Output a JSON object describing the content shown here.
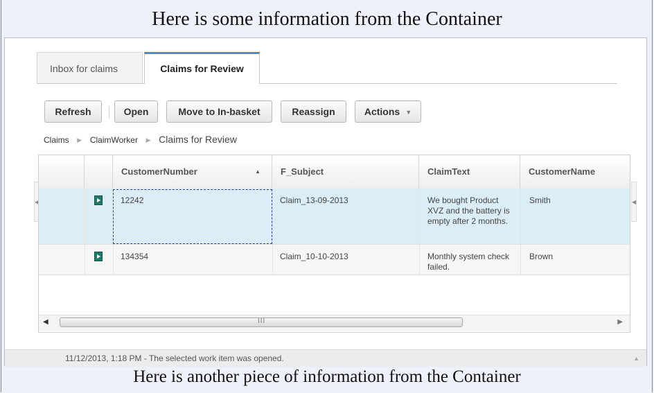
{
  "banner": {
    "top": "Here is some information from the Container",
    "bottom": "Here is another piece of information from the Container"
  },
  "tabs": [
    {
      "label": "Inbox for claims",
      "active": false
    },
    {
      "label": "Claims for Review",
      "active": true
    }
  ],
  "toolbar": {
    "refresh": "Refresh",
    "open": "Open",
    "move": "Move to In-basket",
    "reassign": "Reassign",
    "actions": "Actions"
  },
  "breadcrumb": [
    "Claims",
    "ClaimWorker",
    "Claims for Review"
  ],
  "table": {
    "columns": [
      "CustomerNumber",
      "F_Subject",
      "ClaimText",
      "CustomerName"
    ],
    "sort": {
      "column": "CustomerNumber",
      "direction": "ascending"
    },
    "rows": [
      {
        "icon": "workitem-icon",
        "CustomerNumber": "12242",
        "F_Subject": "Claim_13-09-2013",
        "ClaimText": "We bought Product XVZ and the battery is empty after 2 months.",
        "CustomerName": "Smith",
        "selected": true
      },
      {
        "icon": "workitem-icon",
        "CustomerNumber": "134354",
        "F_Subject": "Claim_10-10-2013",
        "ClaimText": "Monthly system check failed.",
        "CustomerName": "Brown",
        "selected": false
      }
    ],
    "scroll_grip": "III"
  },
  "status": {
    "message": "11/12/2013, 1:18 PM - The selected work item was opened."
  },
  "colors": {
    "selected_row": "#dbeef8",
    "active_tab_accent": "#3d8fd6",
    "icon": "#1f7a6a"
  }
}
